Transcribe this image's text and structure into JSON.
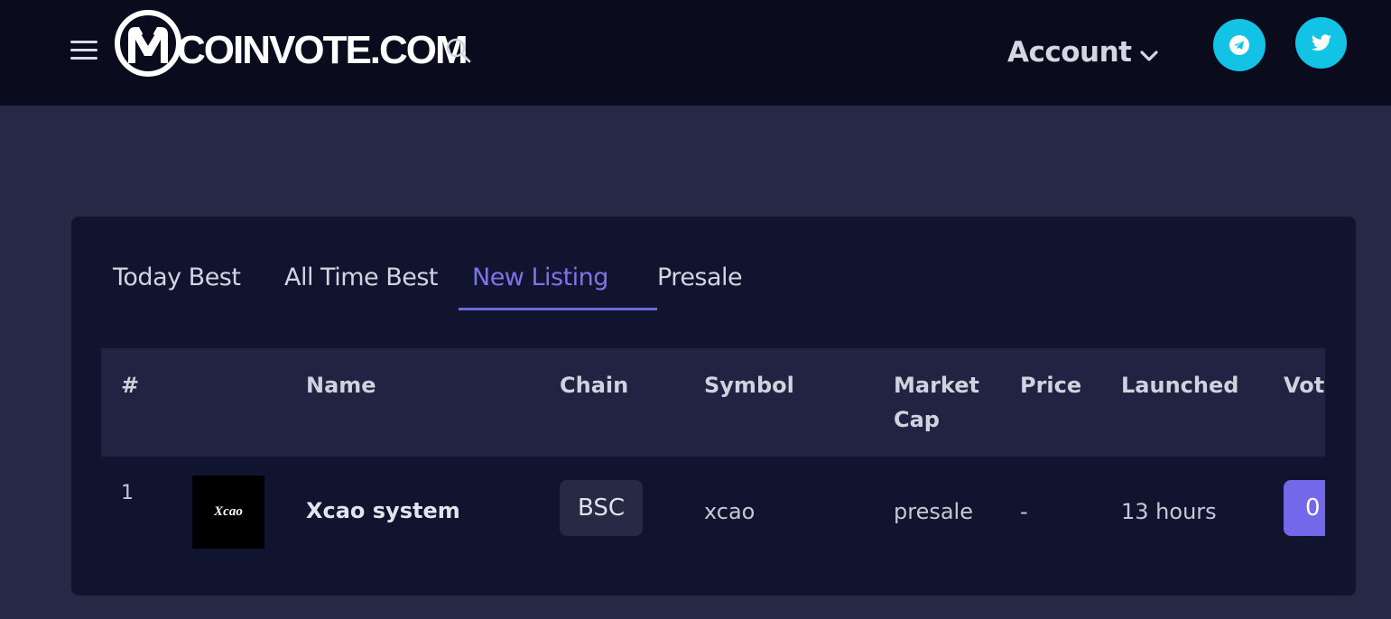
{
  "header": {
    "logo_text": "COINVOTE.COM",
    "account_label": "Account",
    "menu_icon": "hamburger-menu-icon",
    "search_icon": "search-icon",
    "social_links": [
      {
        "name": "telegram",
        "icon": "telegram-icon"
      },
      {
        "name": "twitter",
        "icon": "twitter-icon"
      }
    ]
  },
  "tabs": [
    {
      "label": "Today Best",
      "active": false
    },
    {
      "label": "All Time Best",
      "active": false
    },
    {
      "label": "New Listing",
      "active": true
    },
    {
      "label": "Presale",
      "active": false
    }
  ],
  "table": {
    "columns": [
      "#",
      "Name",
      "Chain",
      "Symbol",
      "Market Cap",
      "Price",
      "Launched",
      "Votes"
    ],
    "column_display": {
      "rank": "#",
      "name": "Name",
      "chain": "Chain",
      "symbol": "Symbol",
      "market_cap_line1": "Market",
      "market_cap_line2": "Cap",
      "price": "Price",
      "launched": "Launched",
      "votes": "Vot"
    },
    "rows": [
      {
        "rank": "1",
        "logo_text": "Xcao",
        "name": "Xcao system",
        "chain": "BSC",
        "symbol": "xcao",
        "market_cap": "presale",
        "price": "-",
        "launched": "13 hours",
        "votes": "0"
      }
    ]
  },
  "colors": {
    "header_bg": "#0b0b1e",
    "page_bg": "#262946",
    "card_bg": "#11142f",
    "table_header_bg": "#202342",
    "accent": "#7367ea",
    "social": "#12c3e6"
  }
}
